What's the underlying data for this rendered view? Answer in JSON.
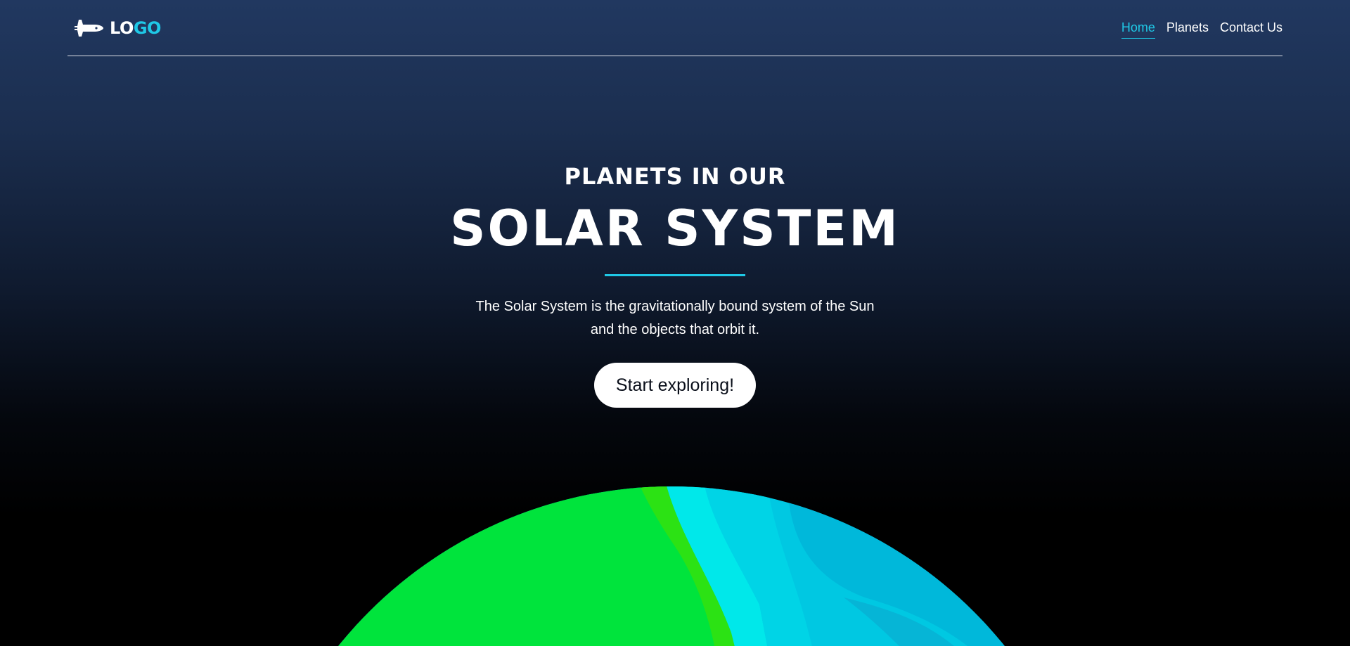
{
  "nav": {
    "logo_part1": "LO",
    "logo_part2": "GO",
    "logo_icon": "space-shuttle-icon",
    "links": [
      {
        "label": "Home",
        "active": true
      },
      {
        "label": "Planets",
        "active": false
      },
      {
        "label": "Contact Us",
        "active": false
      }
    ]
  },
  "hero": {
    "subtitle": "PLANETS IN OUR",
    "title": "SOLAR SYSTEM",
    "description": "The Solar System is the gravitationally bound system of the Sun and the objects that orbit it.",
    "cta_label": "Start exploring!"
  },
  "colors": {
    "accent": "#1fc8e6",
    "planet_green": "#00e43c",
    "planet_cyan": "#00c4e0"
  }
}
